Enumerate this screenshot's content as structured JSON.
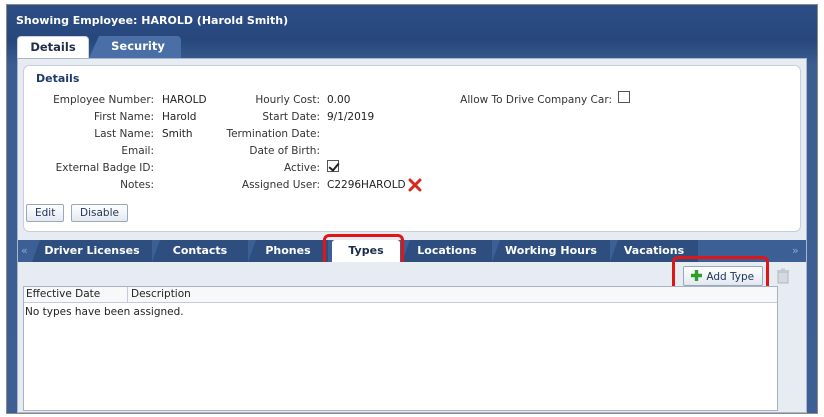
{
  "window": {
    "title": "Showing Employee: HAROLD (Harold Smith)"
  },
  "top_tabs": [
    {
      "label": "Details",
      "active": true
    },
    {
      "label": "Security",
      "active": false
    }
  ],
  "details": {
    "heading": "Details",
    "fields_col1": [
      {
        "label": "Employee Number:",
        "value": "HAROLD"
      },
      {
        "label": "First Name:",
        "value": "Harold"
      },
      {
        "label": "Last Name:",
        "value": "Smith"
      },
      {
        "label": "Email:",
        "value": ""
      },
      {
        "label": "External Badge ID:",
        "value": ""
      },
      {
        "label": "Notes:",
        "value": ""
      }
    ],
    "fields_col2": [
      {
        "label": "Hourly Cost:",
        "value": "0.00"
      },
      {
        "label": "Start Date:",
        "value": "9/1/2019"
      },
      {
        "label": "Termination Date:",
        "value": ""
      },
      {
        "label": "Date of Birth:",
        "value": ""
      },
      {
        "label": "Active:",
        "value": ""
      },
      {
        "label": "Assigned User:",
        "value": "C2296HAROLD"
      }
    ],
    "active_checked": true,
    "allow_drive_label": "Allow To Drive Company Car:",
    "allow_drive_checked": false,
    "edit_label": "Edit",
    "disable_label": "Disable"
  },
  "sub_tabs": [
    {
      "label": "Driver Licenses",
      "active": false
    },
    {
      "label": "Contacts",
      "active": false
    },
    {
      "label": "Phones",
      "active": false
    },
    {
      "label": "Types",
      "active": true
    },
    {
      "label": "Locations",
      "active": false
    },
    {
      "label": "Working Hours",
      "active": false
    },
    {
      "label": "Vacations",
      "active": false
    }
  ],
  "scroll_left_glyph": "«",
  "scroll_right_glyph": "»",
  "types": {
    "add_label": "Add Type",
    "columns": [
      "Effective Date",
      "Description"
    ],
    "empty_message": "No types have been assigned."
  },
  "colors": {
    "header_blue": "#27477c",
    "highlight_red": "#e01616",
    "add_green": "#2f9e2a",
    "remove_red": "#d8281c"
  },
  "icons": {
    "remove": "red-x-icon",
    "add": "green-plus-icon",
    "delete": "trash-icon"
  }
}
